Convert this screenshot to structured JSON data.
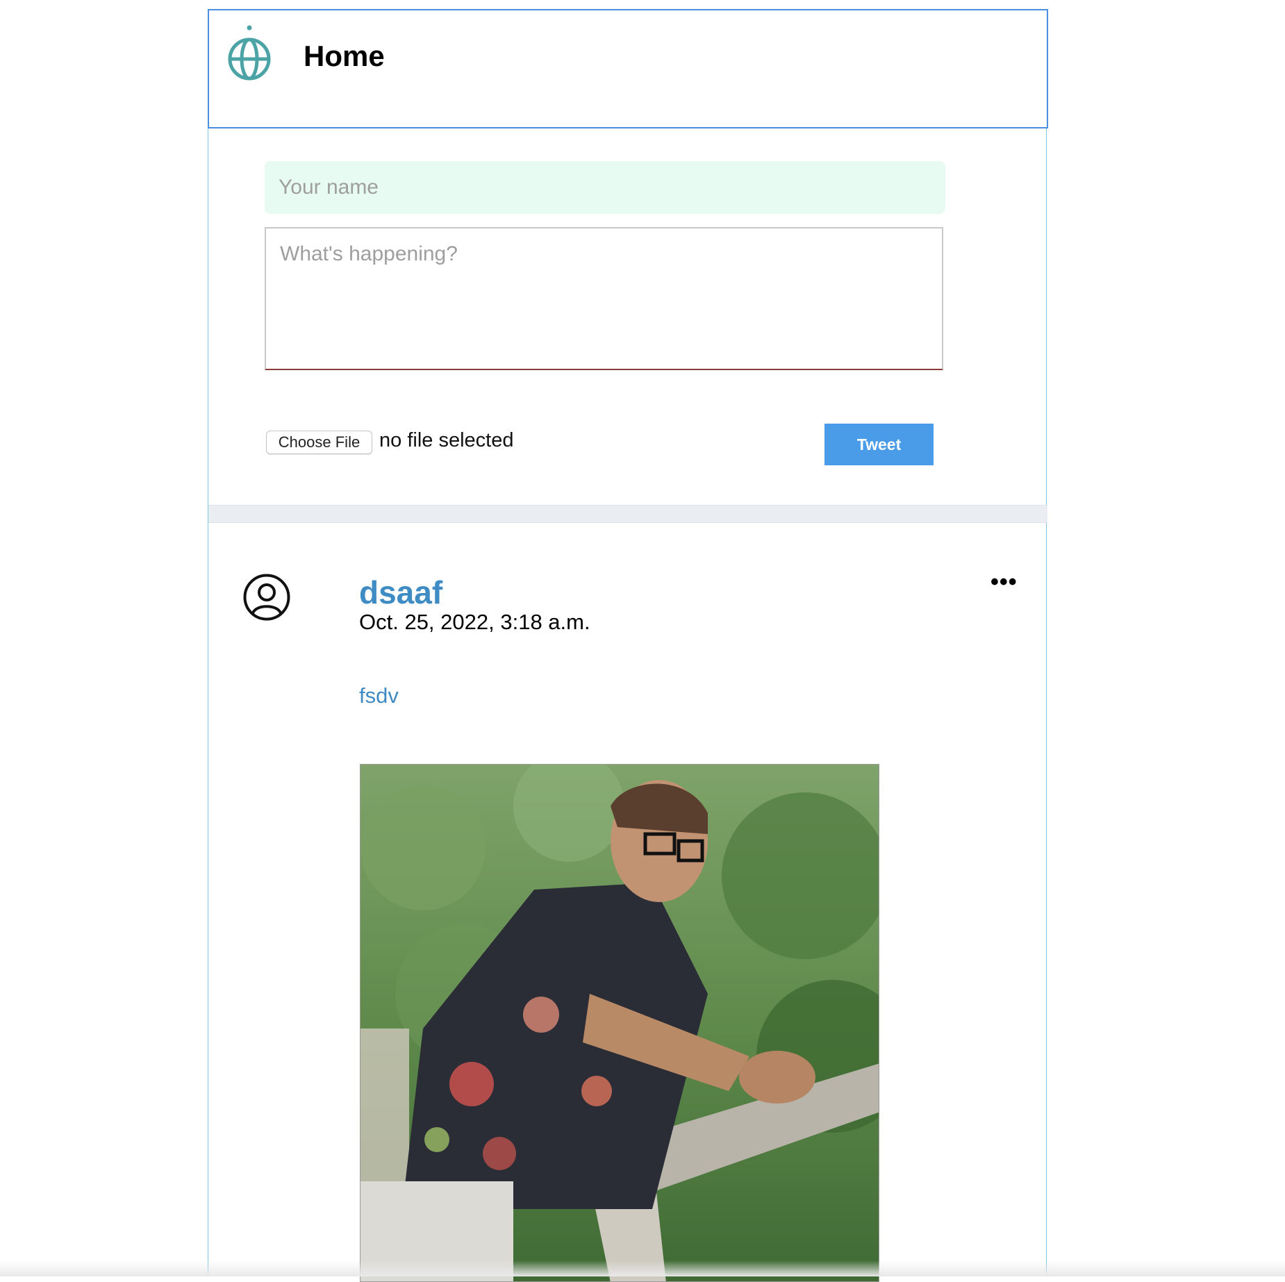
{
  "header": {
    "title": "Home",
    "logo_icon": "globe-icon"
  },
  "composer": {
    "name_placeholder": "Your name",
    "text_placeholder": "What's happening?",
    "file_button_label": "Choose File",
    "file_status": "no file selected",
    "submit_label": "Tweet"
  },
  "posts": [
    {
      "username": "dsaaf",
      "timestamp": "Oct. 25, 2022, 3:18 a.m.",
      "text": "fsdv",
      "avatar_icon": "user-circle-icon",
      "menu_label": "•••"
    }
  ],
  "colors": {
    "accent": "#4a9ce8",
    "link": "#3f8bc4",
    "logo": "#4ba3a6",
    "name_input_bg": "#e8fbf3",
    "divider": "#eaeef3"
  }
}
